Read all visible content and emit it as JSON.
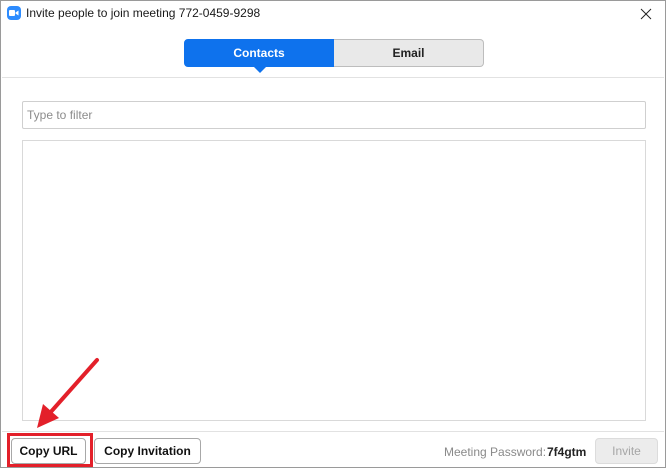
{
  "window": {
    "title": "Invite people to join meeting 772-0459-9298",
    "app_icon": "zoom-camera-icon",
    "close_icon": "close-icon"
  },
  "tabs": [
    {
      "label": "Contacts",
      "active": true
    },
    {
      "label": "Email",
      "active": false
    }
  ],
  "filter": {
    "placeholder": "Type to filter",
    "value": ""
  },
  "footer": {
    "copy_url_label": "Copy URL",
    "copy_invitation_label": "Copy Invitation",
    "password_label": "Meeting Password:",
    "password_value": "7f4gtm",
    "invite_label": "Invite",
    "invite_enabled": false
  },
  "annotation": {
    "color": "#e3202a"
  },
  "colors": {
    "accent": "#0e72ed"
  }
}
